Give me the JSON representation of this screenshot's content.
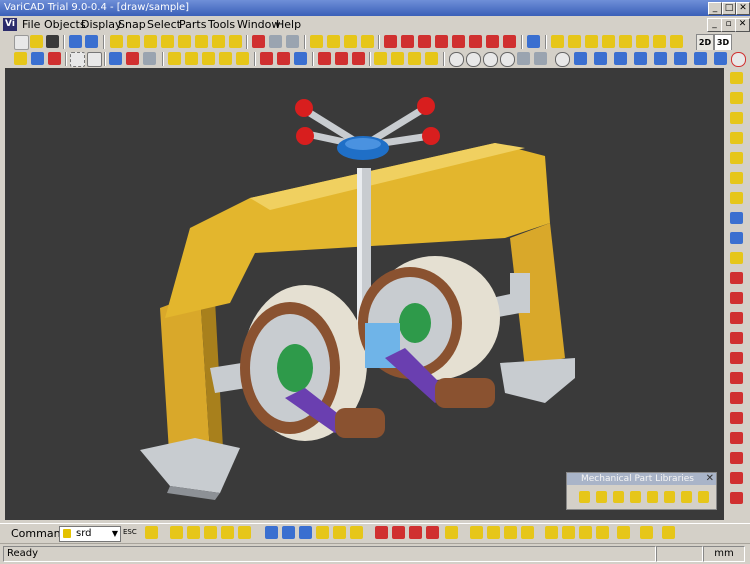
{
  "window": {
    "title": "VariCAD Trial 9.0-0.4 - [draw/sample]",
    "minimize": "_",
    "maximize": "□",
    "close": "✕"
  },
  "menu": {
    "items": [
      {
        "label": "File"
      },
      {
        "label": "Objects"
      },
      {
        "label": "Display"
      },
      {
        "label": "Snap"
      },
      {
        "label": "Select"
      },
      {
        "label": "Parts"
      },
      {
        "label": "Tools"
      },
      {
        "label": "Window"
      },
      {
        "label": "Help"
      }
    ],
    "app_icon": "Vi"
  },
  "toolbar": {
    "view_2d": "2D",
    "view_3d": "3D",
    "accent": "#e6c619",
    "icon_blue": "#3a6fd0",
    "icon_red": "#d03030"
  },
  "libraries_panel": {
    "title": "Mechanical Part Libraries",
    "close": "✕"
  },
  "command": {
    "label": "Command:",
    "value": "srd",
    "esc": "ESC"
  },
  "status": {
    "text": "Ready",
    "units": "mm"
  },
  "colors": {
    "viewport_bg": "#3a3a3a",
    "frame_yellow": "#e3b62d",
    "shaft": "#c8ccd0",
    "handle_blue": "#1f6fc7",
    "knob_red": "#d81e1e",
    "arm_purple": "#6a3fb0",
    "roller_brown": "#8a5230"
  }
}
